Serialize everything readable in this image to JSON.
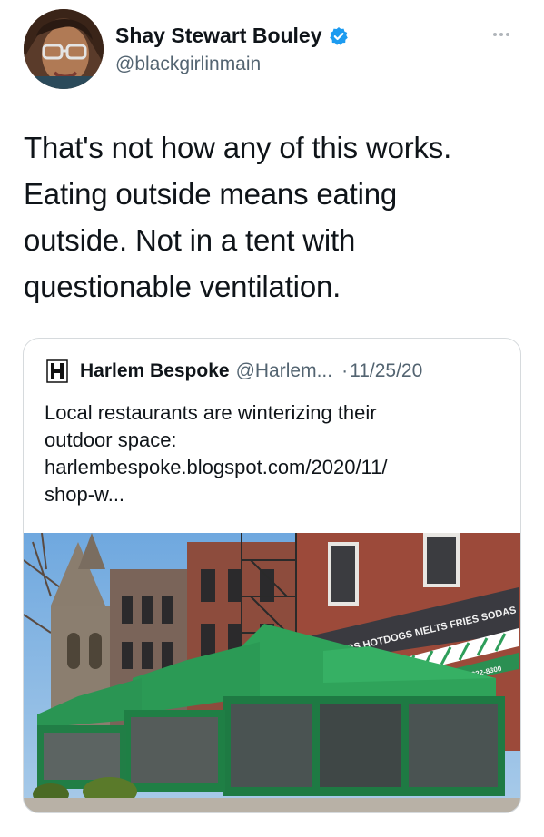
{
  "author": {
    "display_name": "Shay Stewart Bouley",
    "handle": "@blackgirlinmain",
    "verified_icon": "verified-badge-icon"
  },
  "tweet": {
    "lines": [
      "That's not how any of this works.",
      "Eating outside means eating",
      "outside. Not in a tent with",
      "questionable ventilation."
    ]
  },
  "quoted_tweet": {
    "display_name": "Harlem Bespoke",
    "handle": "@Harlem...",
    "separator": "·",
    "date": "11/25/20",
    "lines": [
      "Local restaurants are winterizing their",
      "outdoor space:",
      "harlembespoke.blogspot.com/2020/11/",
      "shop-w..."
    ],
    "image": {
      "awning_text": "BURGERS HOTDOGS MELTS FRIES SODAS",
      "awning_phone": "212-222-8300"
    }
  },
  "colors": {
    "text": "#0f1419",
    "secondary": "#536471",
    "verified": "#1d9bf0",
    "tent_green": "#2e9e5a",
    "brick": "#9c4a3a",
    "sky": "#7fb2e0"
  }
}
